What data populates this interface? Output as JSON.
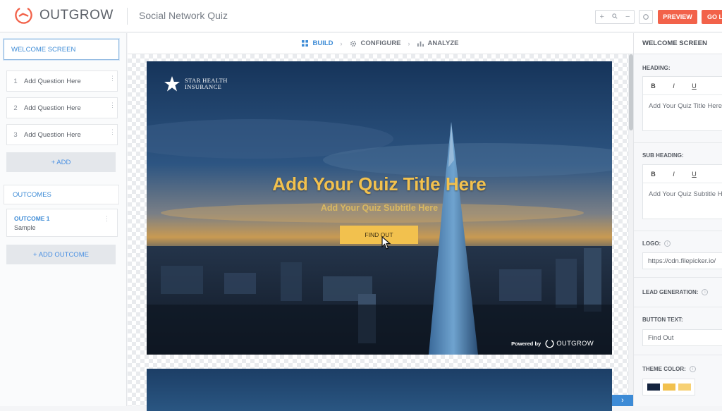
{
  "app": {
    "brand": "OUTGROW",
    "quiz_name": "Social Network Quiz"
  },
  "toolbar": {
    "zoom_in": "+",
    "zoom_search": "🔍",
    "zoom_out": "−",
    "preview_label": "PREVIEW",
    "golive_label": "GO L"
  },
  "left_panel": {
    "welcome_label": "WELCOME SCREEN",
    "questions": [
      {
        "num": "1",
        "label": "Add Question Here"
      },
      {
        "num": "2",
        "label": "Add Question Here"
      },
      {
        "num": "3",
        "label": "Add Question Here"
      }
    ],
    "add_label": "+ ADD",
    "outcomes_label": "OUTCOMES",
    "outcome": {
      "title": "OUTCOME 1",
      "subtitle": "Sample"
    },
    "add_outcome_label": "+ ADD OUTCOME"
  },
  "tabs": [
    {
      "label": "BUILD",
      "active": true,
      "icon": "grid-icon"
    },
    {
      "label": "CONFIGURE",
      "active": false,
      "icon": "gear-icon"
    },
    {
      "label": "ANALYZE",
      "active": false,
      "icon": "bar-chart-icon"
    }
  ],
  "canvas": {
    "brand_line1": "STAR HEALTH",
    "brand_line2": "INSURANCE",
    "title": "Add Your Quiz Title Here",
    "subtitle": "Add Your Quiz Subtitle Here",
    "button": "FIND OUT",
    "powered_by": "Powered by",
    "powered_brand": "OUTGROW"
  },
  "right_panel": {
    "header": "WELCOME SCREEN",
    "heading_label": "HEADING:",
    "heading_text": "Add Your Quiz Title Here",
    "subheading_label": "SUB HEADING:",
    "subheading_text": "Add Your Quiz Subtitle Here",
    "format_bold": "B",
    "format_italic": "I",
    "format_underline": "U",
    "logo_label": "LOGO:",
    "logo_value": "https://cdn.filepicker.io/",
    "lead_label": "LEAD GENERATION:",
    "button_text_label": "BUTTON TEXT:",
    "button_text_value": "Find Out",
    "theme_label": "THEME COLOR:",
    "theme_colors": [
      "#14243f",
      "#f2c14e",
      "#f7d174"
    ]
  },
  "colors": {
    "accent": "#3d8bd6",
    "cta": "#f2624a",
    "title": "#f2c14e"
  }
}
